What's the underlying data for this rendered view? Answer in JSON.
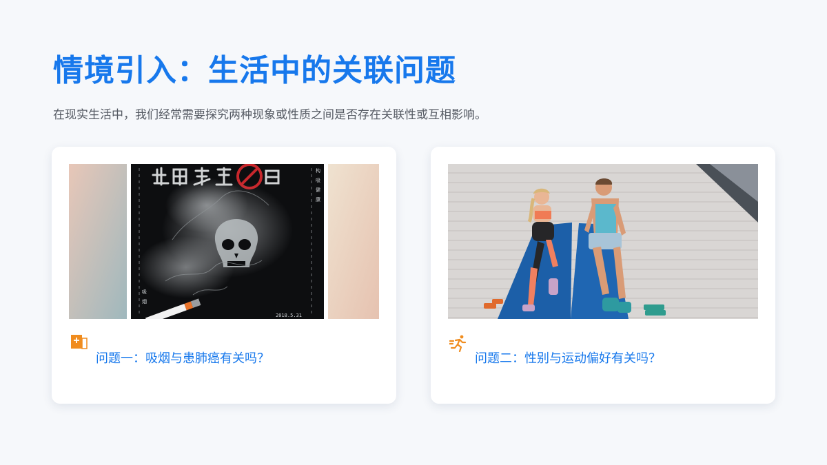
{
  "slide": {
    "title": "情境引入：生活中的关联问题",
    "subtitle": "在现实生活中，我们经常需要探究两种现象或性质之间是否存在关联性或互相影响。"
  },
  "cards": [
    {
      "image": "anti-smoking-poster",
      "icon": "document-plus-icon",
      "question": "问题一：吸烟与患肺癌有关吗？",
      "poster": {
        "side_text": [
          "构",
          "吸",
          "健",
          "康"
        ],
        "bottom_side_text": [
          "吸",
          "烟"
        ],
        "date": "2018.5.31"
      }
    },
    {
      "image": "couple-exercise-photo",
      "icon": "running-person-icon",
      "question": "问题二：性别与运动偏好有关吗？"
    }
  ],
  "colors": {
    "accent": "#1778ec",
    "icon": "#f08c1e",
    "background": "#f6f8fb"
  }
}
